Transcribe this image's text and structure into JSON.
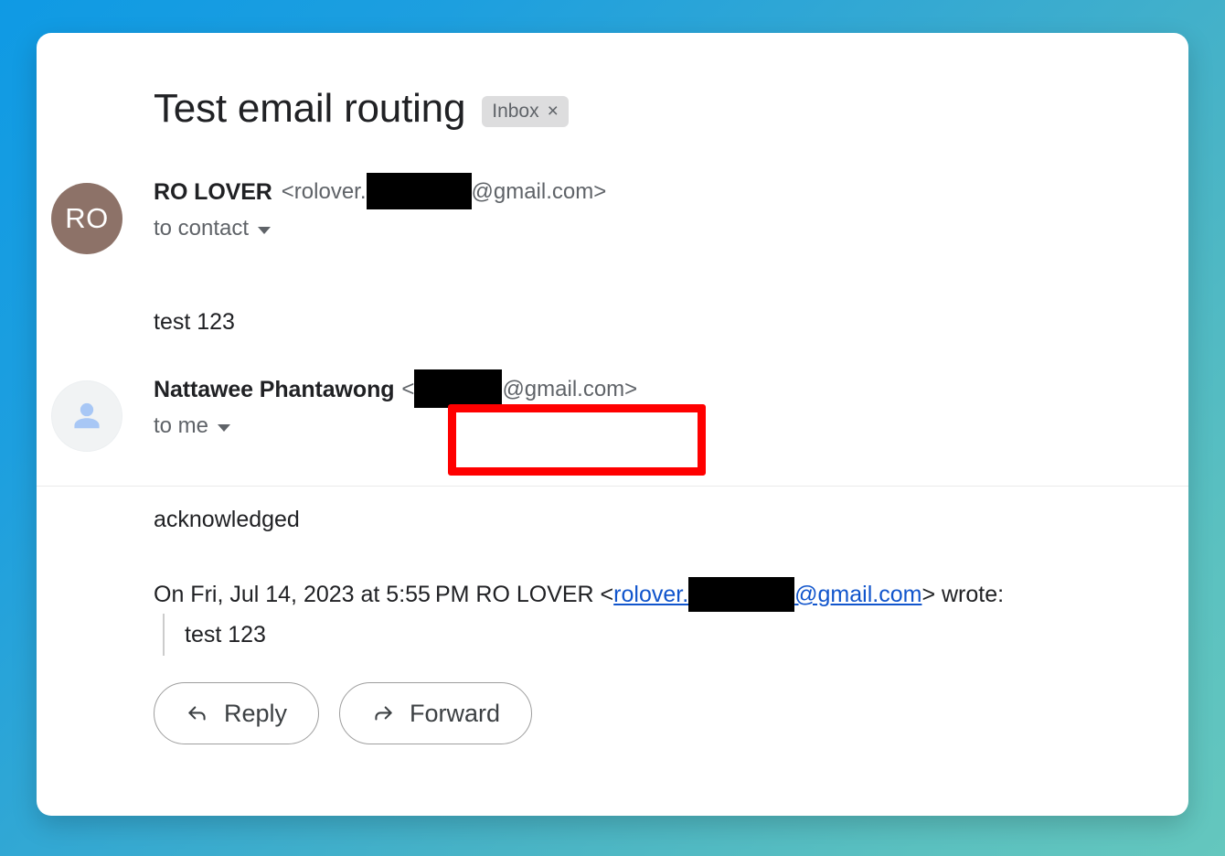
{
  "window": {
    "background_start": "#0f9ae4",
    "background_end": "#64c7be"
  },
  "thread": {
    "subject": "Test email routing",
    "label": {
      "name": "Inbox",
      "close_glyph": "×"
    }
  },
  "messages": [
    {
      "avatar": {
        "type": "initials",
        "initials": "RO",
        "color": "#8d7268"
      },
      "sender_name": "RO LOVER",
      "address_prefix": "<rolover.",
      "address_suffix": "@gmail.com>",
      "recipient": "to contact",
      "body": "test 123"
    },
    {
      "avatar": {
        "type": "person-icon",
        "color": "#a8c7f5"
      },
      "sender_name": "Nattawee Phantawong",
      "address_prefix": "<",
      "address_suffix": "@gmail.com>",
      "recipient": "to me",
      "body": "acknowledged",
      "quote": {
        "intro_before_link": "On Fri, Jul 14, 2023 at 5:55 PM RO LOVER <",
        "link_prefix": "rolover.",
        "link_suffix": "@gmail.com",
        "intro_after_link": "> wrote:",
        "quoted_body": "test 123"
      }
    }
  ],
  "actions": {
    "reply_label": "Reply",
    "forward_label": "Forward"
  },
  "annotation": {
    "highlight_color": "#ff0000"
  }
}
